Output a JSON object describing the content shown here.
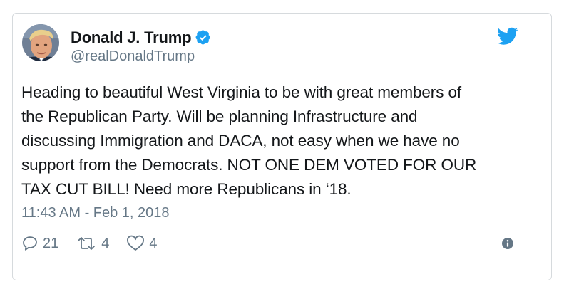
{
  "tweet": {
    "author_name": "Donald J. Trump",
    "author_handle": "@realDonaldTrump",
    "text": "Heading to beautiful West Virginia to be with great members of\nthe Republican Party. Will be planning Infrastructure and\ndiscussing Immigration and DACA, not easy when we have no\nsupport from the Democrats. NOT ONE DEM VOTED FOR OUR\nTAX CUT BILL! Need more Republicans in ‘18.",
    "timestamp": "11:43 AM - Feb 1, 2018",
    "reply_count": "21",
    "retweet_count": "4",
    "like_count": "4"
  },
  "icons": {
    "avatar": "avatar-photo",
    "verified": "verified-badge-icon",
    "brand": "twitter-bird-icon",
    "reply": "reply-icon",
    "retweet": "retweet-icon",
    "like": "heart-icon",
    "info": "info-icon"
  },
  "colors": {
    "brand_blue": "#1da1f2",
    "text_primary": "#14171a",
    "text_secondary": "#657786",
    "border": "#d6dadd"
  }
}
